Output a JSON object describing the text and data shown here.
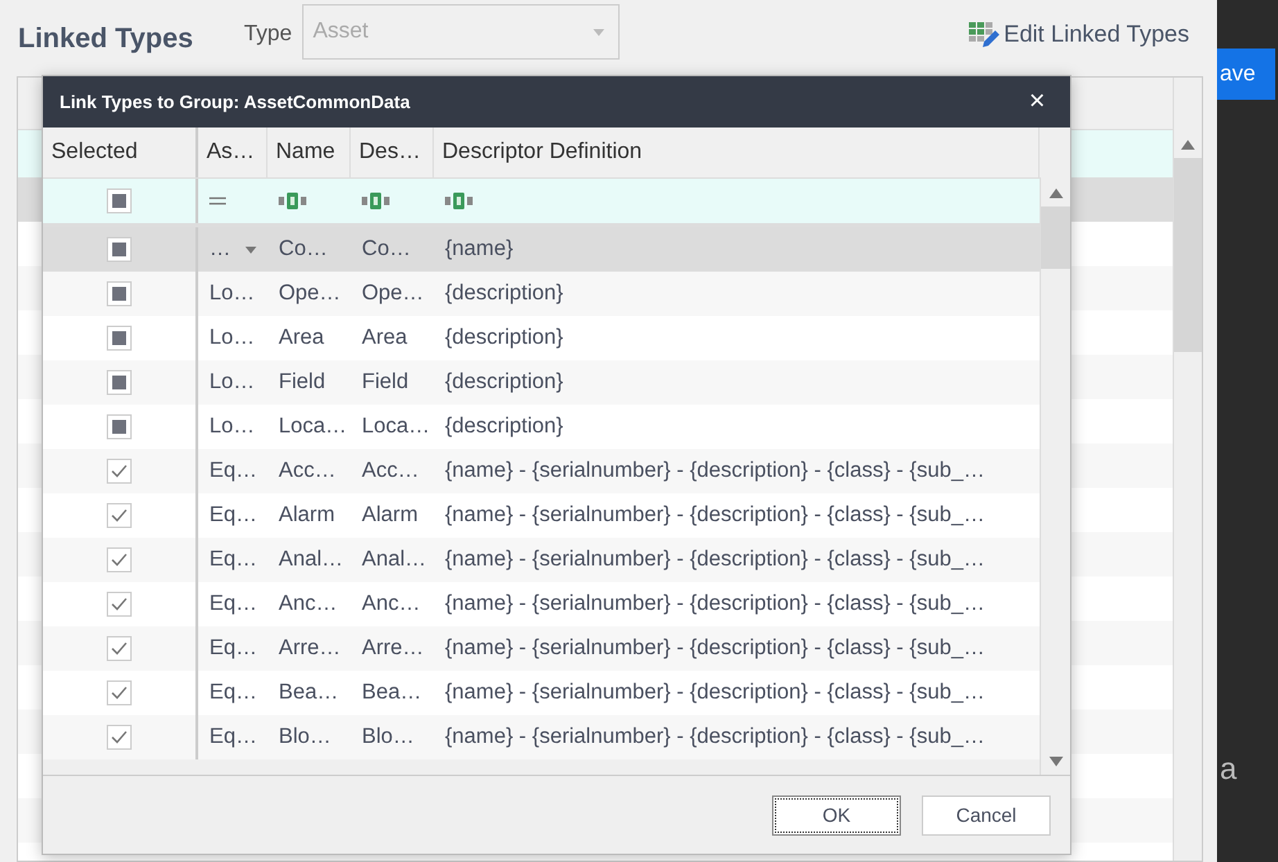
{
  "page": {
    "title": "Linked Types",
    "type_label": "Type",
    "type_value": "Asset",
    "edit_button": "Edit Linked Types"
  },
  "background_grid": {
    "rows": [
      {
        "selected": true
      },
      {
        "selected": false
      },
      {
        "selected": false
      },
      {
        "selected": false
      },
      {
        "selected": false
      },
      {
        "selected": false
      },
      {
        "selected": false
      },
      {
        "selected": false
      },
      {
        "selected": false
      },
      {
        "selected": false
      },
      {
        "selected": false
      },
      {
        "selected": false
      },
      {
        "selected": false
      },
      {
        "selected": false
      },
      {
        "selected": false
      }
    ]
  },
  "side_panel": {
    "button": "ave",
    "text": "a"
  },
  "dialog": {
    "title": "Link Types to Group: AssetCommonData",
    "close": "×",
    "selected_column": "Selected",
    "columns": [
      "As…",
      "Name",
      "Des…",
      "Descriptor Definition"
    ],
    "filter_checkbox": {
      "checked": false
    },
    "rows": [
      {
        "selected": true,
        "checked": false,
        "dropdown": true,
        "cells": [
          "…",
          "Co…",
          "Co…",
          "{name}"
        ]
      },
      {
        "selected": false,
        "checked": false,
        "dropdown": false,
        "cells": [
          "Lo…",
          "Ope…",
          "Ope…",
          "{description}"
        ]
      },
      {
        "selected": false,
        "checked": false,
        "dropdown": false,
        "cells": [
          "Lo…",
          "Area",
          "Area",
          "{description}"
        ]
      },
      {
        "selected": false,
        "checked": false,
        "dropdown": false,
        "cells": [
          "Lo…",
          "Field",
          "Field",
          "{description}"
        ]
      },
      {
        "selected": false,
        "checked": false,
        "dropdown": false,
        "cells": [
          "Lo…",
          "Loca…",
          "Loca…",
          "{description}"
        ]
      },
      {
        "selected": false,
        "checked": true,
        "dropdown": false,
        "cells": [
          "Eq…",
          "Acc…",
          "Acc…",
          "{name} - {serialnumber} - {description} - {class} - {sub_…"
        ]
      },
      {
        "selected": false,
        "checked": true,
        "dropdown": false,
        "cells": [
          "Eq…",
          "Alarm",
          "Alarm",
          "{name} - {serialnumber} - {description} - {class} - {sub_…"
        ]
      },
      {
        "selected": false,
        "checked": true,
        "dropdown": false,
        "cells": [
          "Eq…",
          "Anal…",
          "Anal…",
          "{name} - {serialnumber} - {description} - {class} - {sub_…"
        ]
      },
      {
        "selected": false,
        "checked": true,
        "dropdown": false,
        "cells": [
          "Eq…",
          "Anc…",
          "Anc…",
          "{name} - {serialnumber} - {description} - {class} - {sub_…"
        ]
      },
      {
        "selected": false,
        "checked": true,
        "dropdown": false,
        "cells": [
          "Eq…",
          "Arre…",
          "Arre…",
          "{name} - {serialnumber} - {description} - {class} - {sub_…"
        ]
      },
      {
        "selected": false,
        "checked": true,
        "dropdown": false,
        "cells": [
          "Eq…",
          "Bea…",
          "Bea…",
          "{name} - {serialnumber} - {description} - {class} - {sub_…"
        ]
      },
      {
        "selected": false,
        "checked": true,
        "dropdown": false,
        "cells": [
          "Eq…",
          "Blo…",
          "Blo…",
          "{name} - {serialnumber} - {description} - {class} - {sub_…"
        ]
      }
    ],
    "buttons": [
      {
        "label": "OK",
        "focused": true
      },
      {
        "label": "Cancel",
        "focused": false
      }
    ]
  }
}
